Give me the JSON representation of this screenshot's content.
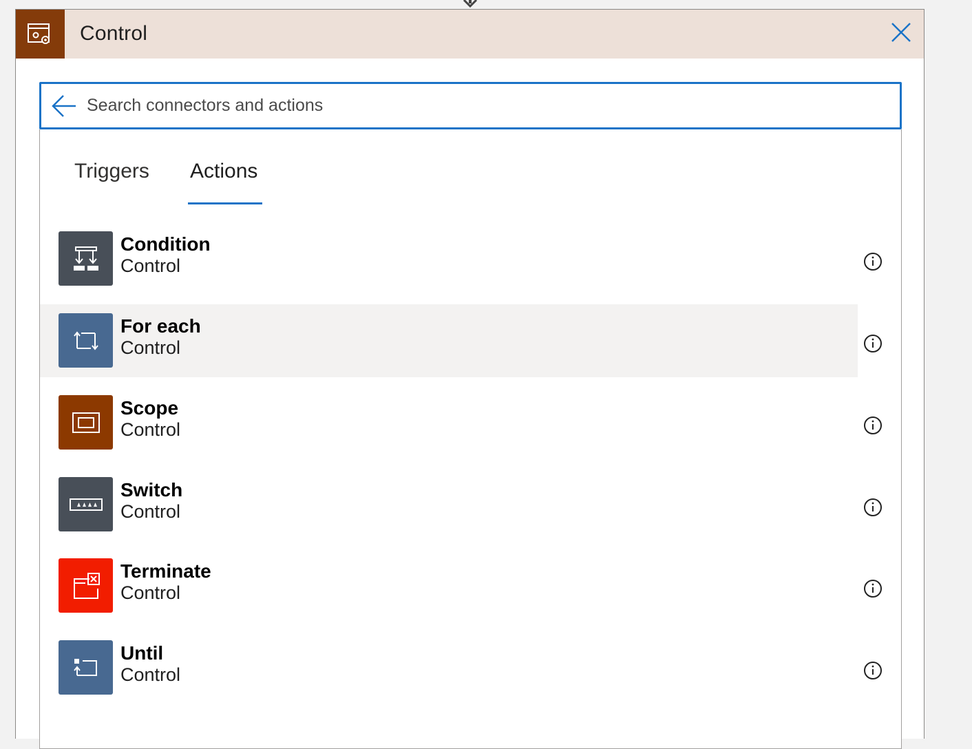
{
  "header": {
    "title": "Control",
    "icon": "control-gear-icon",
    "icon_bg": "#843b0a",
    "bg": "#ede0d8"
  },
  "search": {
    "placeholder": "Search connectors and actions",
    "value": "",
    "accent": "#1a73c7"
  },
  "tabs": [
    {
      "label": "Triggers",
      "selected": false
    },
    {
      "label": "Actions",
      "selected": true
    }
  ],
  "actions": [
    {
      "title": "Condition",
      "subtitle": "Control",
      "icon": "condition-icon",
      "color": "#484f58"
    },
    {
      "title": "For each",
      "subtitle": "Control",
      "icon": "foreach-loop-icon",
      "color": "#486991"
    },
    {
      "title": "Scope",
      "subtitle": "Control",
      "icon": "scope-icon",
      "color": "#8c3900"
    },
    {
      "title": "Switch",
      "subtitle": "Control",
      "icon": "switch-icon",
      "color": "#484f58"
    },
    {
      "title": "Terminate",
      "subtitle": "Control",
      "icon": "terminate-icon",
      "color": "#f21d00"
    },
    {
      "title": "Until",
      "subtitle": "Control",
      "icon": "until-loop-icon",
      "color": "#486991"
    }
  ]
}
